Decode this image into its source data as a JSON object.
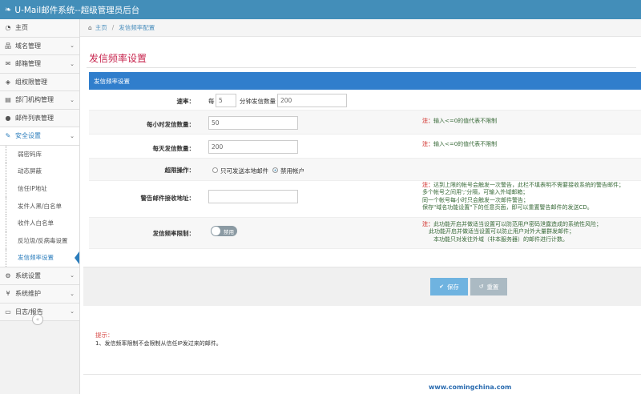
{
  "app": {
    "title": "U-Mail邮件系统--超级管理员后台"
  },
  "sidebar": {
    "items_top": [
      {
        "label": "主页",
        "icon": "tachometer-icon"
      },
      {
        "label": "域名管理",
        "icon": "sitemap-icon"
      },
      {
        "label": "邮箱管理",
        "icon": "envelope-icon"
      },
      {
        "label": "组权限管理",
        "icon": "tags-icon"
      },
      {
        "label": "部门机构管理",
        "icon": "bar-chart-icon"
      },
      {
        "label": "邮件列表管理",
        "icon": "user-icon"
      }
    ],
    "security": {
      "label": "安全设置",
      "icon": "wrench-icon"
    },
    "security_sub": [
      "弱密码库",
      "动态屏蔽",
      "信任IP地址",
      "发件人黑/白名单",
      "收件人白名单",
      "反垃圾/反病毒设置",
      "发信频率设置"
    ],
    "items_bottom": [
      {
        "label": "系统设置",
        "icon": "gear-icon"
      },
      {
        "label": "系统维护",
        "icon": "yen-icon"
      },
      {
        "label": "日志/报告",
        "icon": "desktop-icon"
      }
    ]
  },
  "breadcrumb": {
    "home": "主页",
    "current": "发信频率配置"
  },
  "page": {
    "title": "发信频率设置",
    "panel_title": "发信频率设置"
  },
  "form": {
    "rate": {
      "label": "速率：",
      "prefix": "每",
      "minutes": "5",
      "middle": "分钟发信数量",
      "count": "200"
    },
    "hourly": {
      "label": "每小时发信数量：",
      "value": "50",
      "note_label": "注：",
      "note": "输入<=0的值代表不限制"
    },
    "daily": {
      "label": "每天发信数量：",
      "value": "200",
      "note_label": "注：",
      "note": "输入<=0的值代表不限制"
    },
    "over": {
      "label": "超限操作：",
      "option1": "只可发送本地邮件",
      "option2": "禁用帐户",
      "selected": "禁用帐户"
    },
    "alert": {
      "label": "警告邮件接收地址：",
      "value": "",
      "note_label": "注：",
      "note_lines": [
        "达到上限的帐号会触发一次警告，此栏不填表明不需要接收系统的警告邮件；",
        "多个帐号之间用';'分隔，可输入外域邮箱；",
        "同一个帐号每小时只会触发一次邮件警告；",
        "保存\"域名功能设置\"下的任意页面，即可以重置警告邮件的发送CD。"
      ]
    },
    "limit": {
      "label": "发信频率限制：",
      "toggle": "禁用",
      "note_label": "注：",
      "note_lines": [
        "此功能开启并做适当设置可以防范用户密码泄露造成的系统性风险；",
        "此功能开启并做适当设置可以防止用户对外大量群发邮件；",
        "本功能只对发往外域（非本服务器）的邮件进行计数。"
      ]
    }
  },
  "actions": {
    "save": "保存",
    "reset": "重置"
  },
  "tips": {
    "title": "提示：",
    "text": "1、发信频率限制不会限制从信任IP发过来的邮件。"
  },
  "footer": {
    "text": "www.comingchina.com"
  }
}
